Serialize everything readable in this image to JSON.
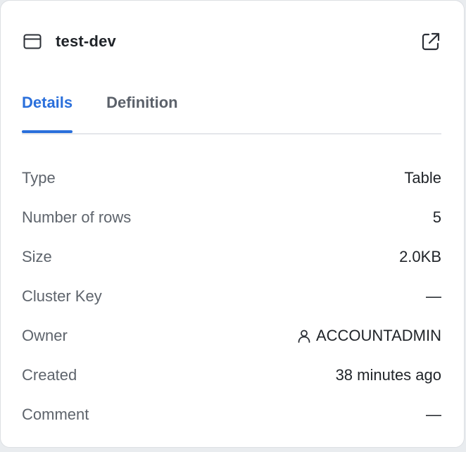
{
  "header": {
    "title": "test-dev",
    "icon": "table-icon",
    "action_icon": "open-external-icon"
  },
  "tabs": [
    {
      "label": "Details",
      "active": true
    },
    {
      "label": "Definition",
      "active": false
    }
  ],
  "details": [
    {
      "label": "Type",
      "value": "Table"
    },
    {
      "label": "Number of rows",
      "value": "5"
    },
    {
      "label": "Size",
      "value": "2.0KB"
    },
    {
      "label": "Cluster Key",
      "value": "—"
    },
    {
      "label": "Owner",
      "value": "ACCOUNTADMIN",
      "icon": "user-icon"
    },
    {
      "label": "Created",
      "value": "38 minutes ago"
    },
    {
      "label": "Comment",
      "value": "—"
    }
  ],
  "colors": {
    "accent": "#2a6fdb",
    "text": "#1f2328",
    "muted": "#5e646c"
  }
}
